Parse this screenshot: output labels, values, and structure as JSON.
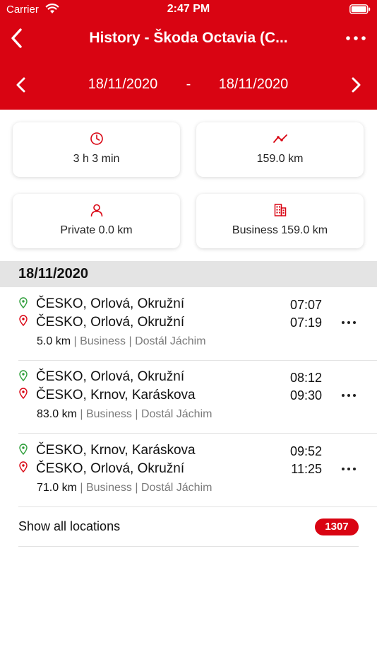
{
  "status_bar": {
    "carrier": "Carrier",
    "time": "2:47 PM"
  },
  "nav": {
    "title": "History - Škoda Octavia (C..."
  },
  "date_range": {
    "from": "18/11/2020",
    "separator": "-",
    "to": "18/11/2020"
  },
  "summary": {
    "duration": "3 h 3 min",
    "distance": "159.0 km",
    "private": "Private 0.0 km",
    "business": "Business 159.0 km"
  },
  "section": {
    "date": "18/11/2020"
  },
  "trips": [
    {
      "from": "ČESKO, Orlová, Okružní",
      "to": "ČESKO, Orlová, Okružní",
      "start_time": "07:07",
      "end_time": "07:19",
      "distance": "5.0 km",
      "type": "Business",
      "driver": "Dostál Jáchim"
    },
    {
      "from": "ČESKO, Orlová, Okružní",
      "to": "ČESKO, Krnov, Karáskova",
      "start_time": "08:12",
      "end_time": "09:30",
      "distance": "83.0 km",
      "type": "Business",
      "driver": "Dostál Jáchim"
    },
    {
      "from": "ČESKO, Krnov, Karáskova",
      "to": "ČESKO, Orlová, Okružní",
      "start_time": "09:52",
      "end_time": "11:25",
      "distance": "71.0 km",
      "type": "Business",
      "driver": "Dostál Jáchim"
    }
  ],
  "show_all": {
    "label": "Show all locations",
    "count": "1307"
  },
  "icons": {
    "back": "chevron-left-icon",
    "more": "more-horizontal-icon",
    "prev": "chevron-left-icon",
    "next": "chevron-right-icon",
    "duration": "clock-icon",
    "distance": "route-icon",
    "private": "person-icon",
    "business": "building-icon",
    "start": "green-pin-icon",
    "end": "red-pin-icon"
  },
  "colors": {
    "brand_red": "#d90412",
    "start_pin": "#2e9e3a",
    "end_pin": "#d90412",
    "muted_text": "#7a7a7a",
    "section_bg": "#e4e4e4"
  }
}
